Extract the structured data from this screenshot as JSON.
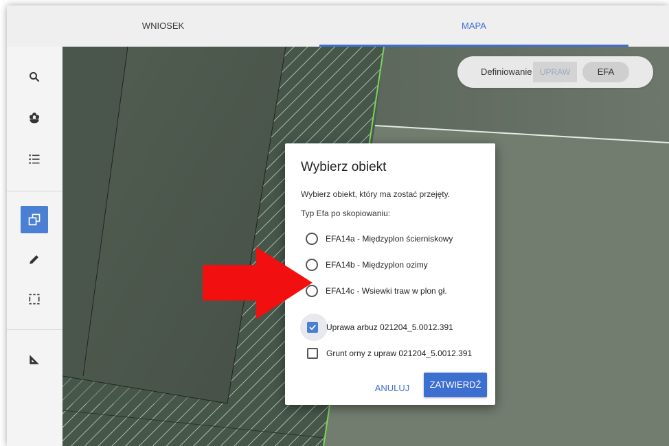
{
  "tabs": {
    "request_label": "WNIOSEK",
    "map_label": "MAPA"
  },
  "toolbar": {
    "items": [
      {
        "icon": "search-icon"
      },
      {
        "icon": "flower-icon"
      },
      {
        "icon": "list-icon"
      },
      {
        "icon": "copy-icon",
        "active": true
      },
      {
        "icon": "pencil-icon"
      },
      {
        "icon": "select-area-icon"
      },
      {
        "icon": "ruler-icon"
      }
    ]
  },
  "definition": {
    "label": "Definiowanie",
    "crops": "UPRAW",
    "efa": "EFA"
  },
  "dialog": {
    "title": "Wybierz obiekt",
    "description": "Wybierz obiekt, który ma zostać przejęty.",
    "type_label": "Typ Efa po skopiowaniu:",
    "radio_options": [
      {
        "label": "EFA14a - Międzyplon ścierniskowy"
      },
      {
        "label": "EFA14b - Międzyplon ozimy"
      },
      {
        "label": "EFA14c - Wsiewki traw w plon gł."
      }
    ],
    "checkbox_options": [
      {
        "label": "Uprawa arbuz 021204_5.0012.391",
        "checked": true
      },
      {
        "label": "Grunt orny z upraw 021204_5.0012.391",
        "checked": false
      }
    ],
    "cancel_label": "ANULUJ",
    "confirm_label": "ZATWIERDŹ"
  },
  "colors": {
    "accent": "#3d6fd0",
    "arrow": "#f10f0f",
    "field_boundary": "#7bd65a"
  }
}
